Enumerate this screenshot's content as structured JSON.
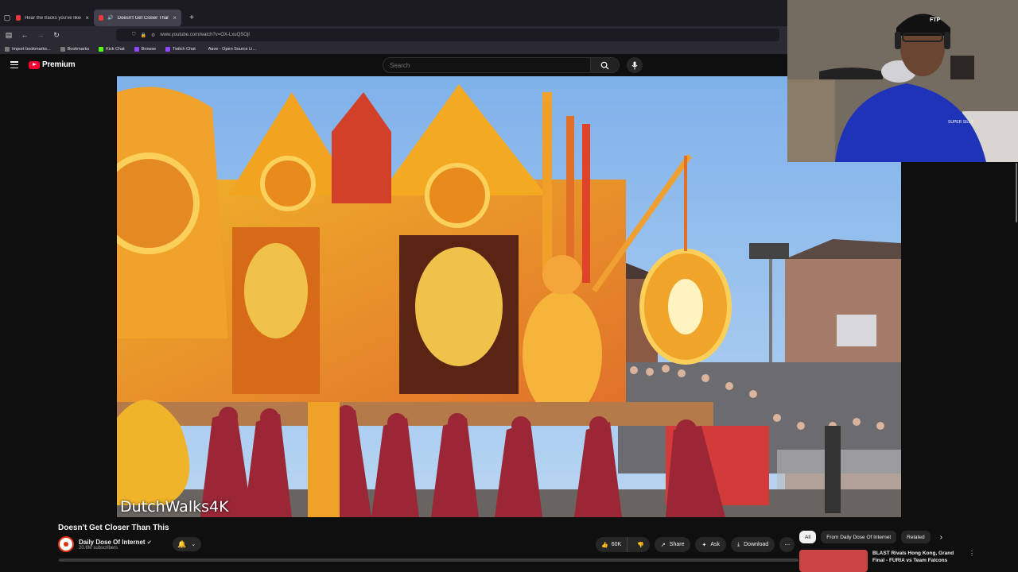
{
  "browser": {
    "tabs": [
      {
        "label": "Hear the tracks you've liked: or"
      },
      {
        "label": "Doesn't Get Closer Than Th"
      }
    ],
    "url": "www.youtube.com/watch?v=OX-LxuQSOjI",
    "bookmarks": [
      {
        "label": "Import bookmarks..."
      },
      {
        "label": "Bookmarks"
      },
      {
        "label": "Kick Chat"
      },
      {
        "label": "Browse"
      },
      {
        "label": "Twitch Chat"
      },
      {
        "label": "Aave - Open Source Li..."
      }
    ]
  },
  "youtube": {
    "logo_text": "Premium",
    "search_placeholder": "Search",
    "video": {
      "watermark": "DutchWalks4K",
      "title": "Doesn't Get Closer Than This"
    },
    "channel": {
      "name": "Daily Dose Of Internet",
      "subscribers": "20.6M subscribers"
    },
    "actions": {
      "likes": "60K",
      "share": "Share",
      "ask": "Ask",
      "download": "Download"
    },
    "chips": [
      "All",
      "From Daily Dose Of Internet",
      "Related"
    ],
    "recommendation": {
      "title": "BLAST Rivals Hong Kong, Grand Final - FURIA vs Team Falcons"
    }
  },
  "webcam": {
    "cap_text": "FTP",
    "hoodie_text": "SUPER SILLY"
  }
}
